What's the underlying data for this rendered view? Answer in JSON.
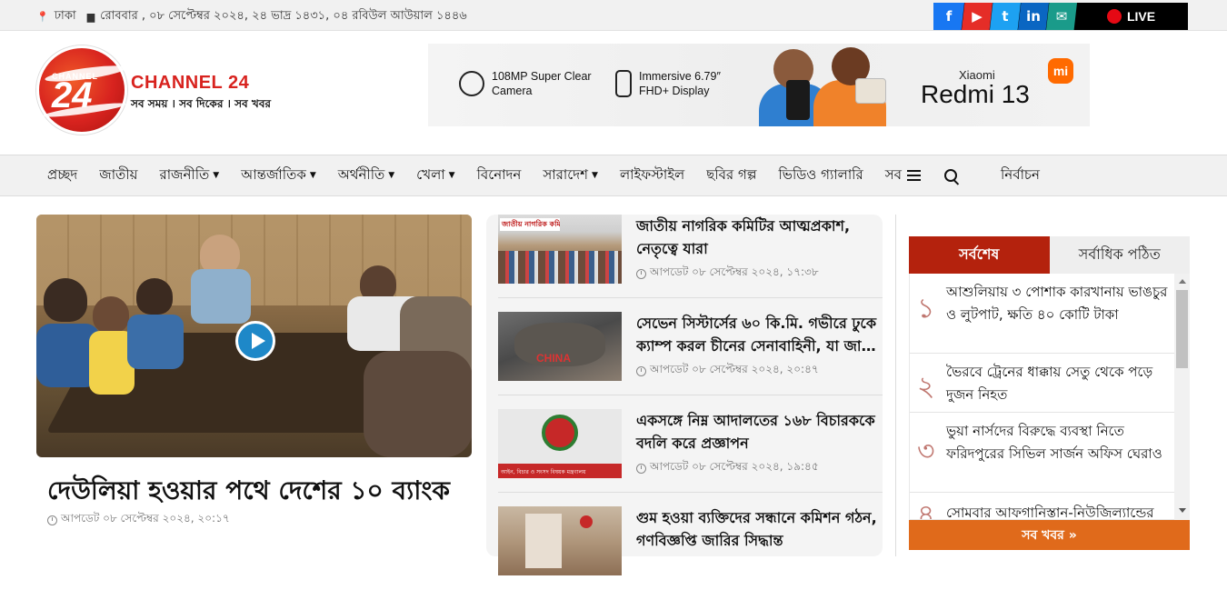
{
  "topbar": {
    "location": "ঢাকা",
    "date_text": "রোববার , ০৮ সেপ্টেম্বর ২০২৪, ২৪ ভাদ্র ১৪৩১, ০৪ রবিউল আউয়াল ১৪৪৬",
    "social": [
      {
        "icon": "facebook-icon",
        "glyph": "f",
        "color": "#1877f2"
      },
      {
        "icon": "youtube-icon",
        "glyph": "▶",
        "color": "#e52d27"
      },
      {
        "icon": "twitter-icon",
        "glyph": "t",
        "color": "#1da1f2"
      },
      {
        "icon": "linkedin-icon",
        "glyph": "in",
        "color": "#0a66c2"
      },
      {
        "icon": "email-icon",
        "glyph": "✉",
        "color": "#1a9b8a"
      }
    ],
    "live_label": "LIVE"
  },
  "header": {
    "logo_channel": "CHANNEL",
    "logo_number": "24",
    "brand": "CHANNEL 24",
    "slogan": "সব সময় । সব দিকের । সব খবর"
  },
  "ad": {
    "feature1": "108MP Super Clear\nCamera",
    "feature1_a": "108MP Super Clear",
    "feature1_b": "Camera",
    "feature2_a": "Immersive 6.79″",
    "feature2_b": "FHD+ Display",
    "brand": "Xiaomi",
    "model": "Redmi 13",
    "mi": "mi"
  },
  "nav": {
    "items": [
      {
        "label": "প্রচ্ছদ",
        "dropdown": false
      },
      {
        "label": "জাতীয়",
        "dropdown": false
      },
      {
        "label": "রাজনীতি",
        "dropdown": true
      },
      {
        "label": "আন্তর্জাতিক",
        "dropdown": true
      },
      {
        "label": "অর্থনীতি",
        "dropdown": true
      },
      {
        "label": "খেলা",
        "dropdown": true
      },
      {
        "label": "বিনোদন",
        "dropdown": false
      },
      {
        "label": "সারাদেশ",
        "dropdown": true
      },
      {
        "label": "লাইফস্টাইল",
        "dropdown": false
      },
      {
        "label": "ছবির গল্প",
        "dropdown": false
      },
      {
        "label": "ভিডিও গ্যালারি",
        "dropdown": false
      }
    ],
    "more_label": "সব",
    "election_label": "নির্বাচন"
  },
  "lead": {
    "title": "দেউলিয়া হওয়ার পথে দেশের ১০ ব্যাংক",
    "updated": "আপডেট ০৮ সেপ্টেম্বর ২০২৪, ২০:১৭"
  },
  "stories": [
    {
      "title": "জাতীয় নাগরিক কমিটির আত্মপ্রকাশ, নেতৃত্বে যারা",
      "updated": "আপডেট ০৮ সেপ্টেম্বর ২০২৪, ১৭:৩৮"
    },
    {
      "title_line1": "সেভেন সিস্টার্সের ৬০ কি.মি. গভীরে ঢুকে",
      "title_line2": "ক্যাম্প করল চীনের সেনাবাহিনী, যা জানা...",
      "updated": "আপডেট ০৮ সেপ্টেম্বর ২০২৪, ২০:৪৭"
    },
    {
      "title": "একসঙ্গে নিম্ন আদালতের ১৬৮ বিচারককে বদলি করে প্রজ্ঞাপন",
      "updated": "আপডেট ০৮ সেপ্টেম্বর ২০২৪, ১৯:৪৫"
    },
    {
      "title": "গুম হওয়া ব্যক্তিদের সন্ধানে কমিশন গঠন, গণবিজ্ঞপ্তি জারির সিদ্ধান্ত"
    }
  ],
  "thumb_texts": {
    "story1_banner": "জাতীয় নাগরিক কমিটি",
    "story2_graffiti": "CHINA",
    "story3_caption": "আইন, বিচার ও সংসদ বিষয়ক মন্ত্রণালয়"
  },
  "sidebar": {
    "tab_latest": "সর্বশেষ",
    "tab_popular": "সর্বাধিক পঠিত",
    "items": [
      {
        "num": "১",
        "text": "আশুলিয়ায় ৩ পোশাক কারখানায় ভাঙচুর ও লুটপাট, ক্ষতি ৪০ কোটি টাকা"
      },
      {
        "num": "২",
        "text": "ভৈরবে ট্রেনের ধাক্কায় সেতু থেকে পড়ে দুজন নিহত"
      },
      {
        "num": "৩",
        "text": "ভুয়া নার্সদের বিরুদ্ধে ব্যবস্থা নিতে ফরিদপুরের সিভিল সার্জন অফিস ঘেরাও"
      },
      {
        "num": "৪",
        "text": "সোমবার আফগানিস্তান-নিউজিল্যান্ডের"
      }
    ],
    "all_news": "সব খবর »"
  }
}
